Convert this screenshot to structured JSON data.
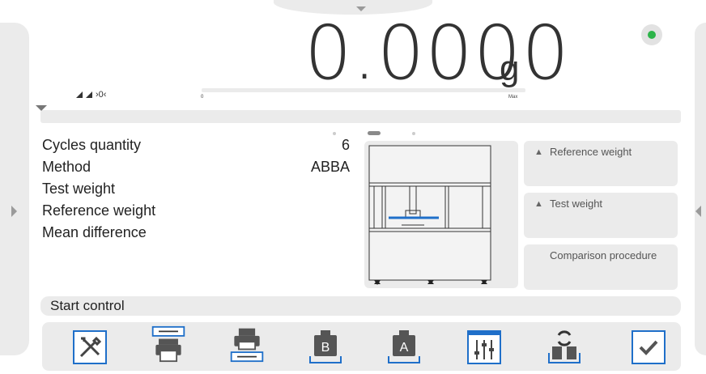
{
  "weighing": {
    "reading": "0.0000",
    "unit": "g",
    "indicator_text": "›0‹",
    "bar_min": "0",
    "bar_max": "Max"
  },
  "parameters": [
    {
      "label": "Cycles quantity",
      "value": "6"
    },
    {
      "label": "Method",
      "value": "ABBA"
    },
    {
      "label": "Test weight",
      "value": ""
    },
    {
      "label": "Reference weight",
      "value": ""
    },
    {
      "label": "Mean difference",
      "value": ""
    }
  ],
  "tiles": {
    "reference_weight": "Reference weight",
    "test_weight": "Test weight",
    "comparison_procedure": "Comparison procedure"
  },
  "start_control": "Start control",
  "pager": {
    "pages": 3,
    "active_page": 2
  },
  "toolbar": {
    "buttons": [
      "settings",
      "print-header",
      "print",
      "print-footer",
      "weight-b",
      "weight-a",
      "parameters",
      "swap-weights",
      "confirm"
    ]
  },
  "colors": {
    "accent": "#1f6fc9",
    "status": "#2db44a",
    "panel": "#ebebeb"
  }
}
